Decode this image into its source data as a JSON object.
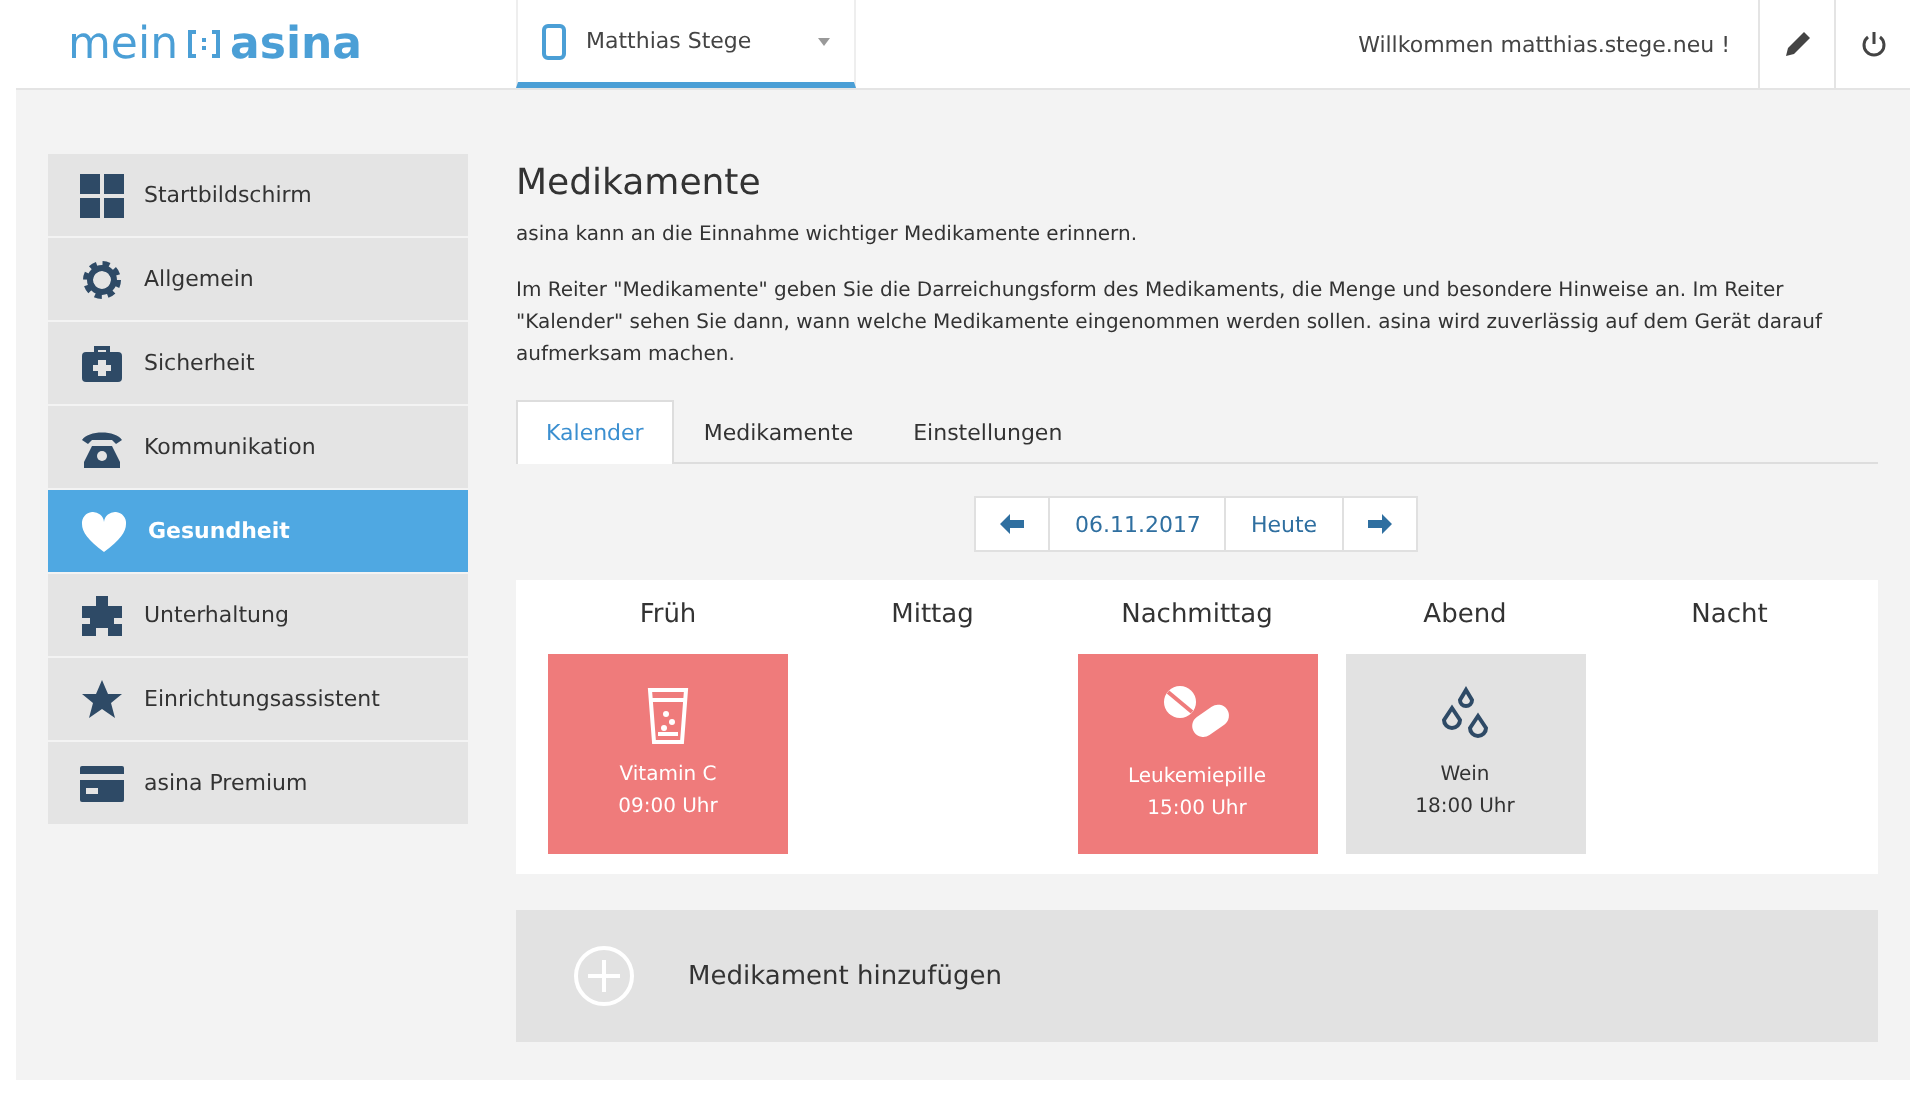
{
  "header": {
    "logo": {
      "left": "mein",
      "right": "asina"
    },
    "user_select": {
      "value": "Matthias Stege"
    },
    "welcome": "Willkommen matthias.stege.neu !"
  },
  "sidebar": {
    "items": [
      {
        "label": "Startbildschirm",
        "selected": false
      },
      {
        "label": "Allgemein",
        "selected": false
      },
      {
        "label": "Sicherheit",
        "selected": false
      },
      {
        "label": "Kommunikation",
        "selected": false
      },
      {
        "label": "Gesundheit",
        "selected": true
      },
      {
        "label": "Unterhaltung",
        "selected": false
      },
      {
        "label": "Einrichtungsassistent",
        "selected": false
      },
      {
        "label": "asina Premium",
        "selected": false
      }
    ]
  },
  "page": {
    "title": "Medikamente",
    "intro": "asina kann an die Einnahme wichtiger Medikamente erinnern.",
    "description": "Im Reiter \"Medikamente\" geben Sie die Darreichungsform des Medikaments, die Menge und besondere Hinweise an. Im Reiter \"Kalender\" sehen Sie dann, wann welche Medikamente eingenommen werden sollen. asina wird zuverlässig auf dem Gerät darauf aufmerksam machen.",
    "tabs": [
      {
        "label": "Kalender",
        "selected": true
      },
      {
        "label": "Medikamente",
        "selected": false
      },
      {
        "label": "Einstellungen",
        "selected": false
      }
    ],
    "date_nav": {
      "date": "06.11.2017",
      "today": "Heute"
    },
    "calendar": {
      "slots": [
        {
          "label": "Früh",
          "meds": [
            {
              "name": "Vitamin C",
              "time": "09:00 Uhr",
              "color": "#ef7b7b"
            }
          ]
        },
        {
          "label": "Mittag"
        },
        {
          "label": "Nachmittag",
          "meds": [
            {
              "name": "Leukemiepille",
              "time": "15:00 Uhr",
              "color": "#ef7b7b"
            }
          ]
        },
        {
          "label": "Abend",
          "meds": [
            {
              "name": "Wein",
              "time": "18:00 Uhr",
              "color": "#e2e2e2"
            }
          ]
        },
        {
          "label": "Nacht"
        }
      ]
    },
    "add_button": "Medikament hinzufügen"
  }
}
